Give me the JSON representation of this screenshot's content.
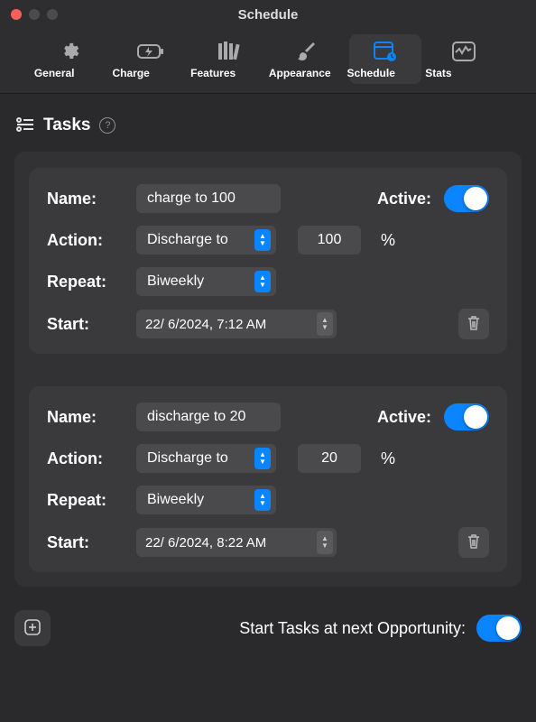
{
  "window": {
    "title": "Schedule"
  },
  "toolbar": {
    "items": [
      {
        "label": "General"
      },
      {
        "label": "Charge"
      },
      {
        "label": "Features"
      },
      {
        "label": "Appearance"
      },
      {
        "label": "Schedule"
      },
      {
        "label": "Stats"
      }
    ],
    "active_index": 4
  },
  "section": {
    "title": "Tasks"
  },
  "labels": {
    "name": "Name:",
    "action": "Action:",
    "repeat": "Repeat:",
    "start": "Start:",
    "active": "Active:",
    "percent": "%"
  },
  "tasks": [
    {
      "name": "charge to 100",
      "active": true,
      "action": "Discharge to",
      "value": "100",
      "repeat": "Biweekly",
      "start": "22/ 6/2024,  7:12 AM"
    },
    {
      "name": "discharge to 20",
      "active": true,
      "action": "Discharge to",
      "value": "20",
      "repeat": "Biweekly",
      "start": "22/ 6/2024,  8:22 AM"
    }
  ],
  "footer": {
    "opportunity_label": "Start Tasks at next Opportunity:",
    "opportunity_on": true
  }
}
